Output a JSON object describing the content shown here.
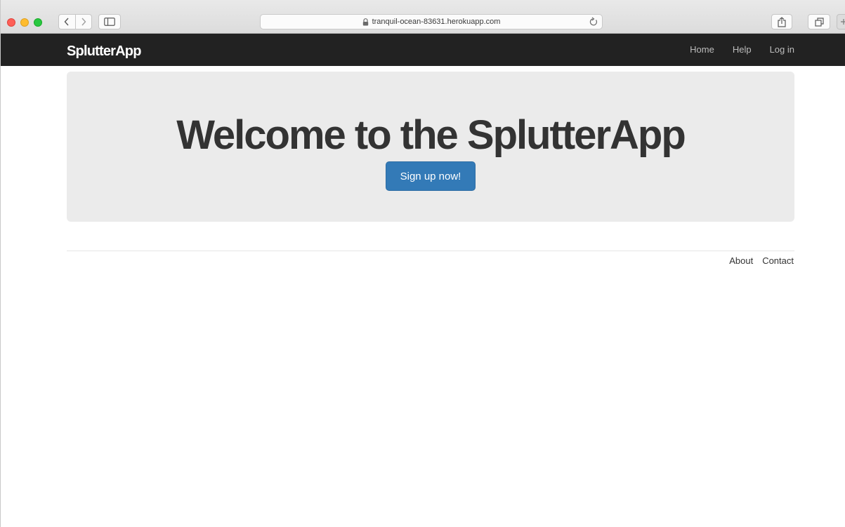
{
  "browser": {
    "url": "tranquil-ocean-83631.herokuapp.com",
    "icons": {
      "back": "chevron-left-icon",
      "forward": "chevron-right-icon",
      "sidebar": "sidebar-icon",
      "lock": "lock-icon",
      "reload": "reload-icon",
      "share": "share-icon",
      "tabs": "tabs-icon",
      "new_tab": "plus-icon"
    }
  },
  "navbar": {
    "brand": "SplutterApp",
    "links": [
      {
        "label": "Home"
      },
      {
        "label": "Help"
      },
      {
        "label": "Log in"
      }
    ]
  },
  "hero": {
    "title": "Welcome to the SplutterApp",
    "cta_label": "Sign up now!"
  },
  "footer": {
    "links": [
      {
        "label": "About"
      },
      {
        "label": "Contact"
      }
    ]
  },
  "colors": {
    "navbar_bg": "#222222",
    "jumbotron_bg": "#ebebeb",
    "primary_button": "#337ab7"
  }
}
